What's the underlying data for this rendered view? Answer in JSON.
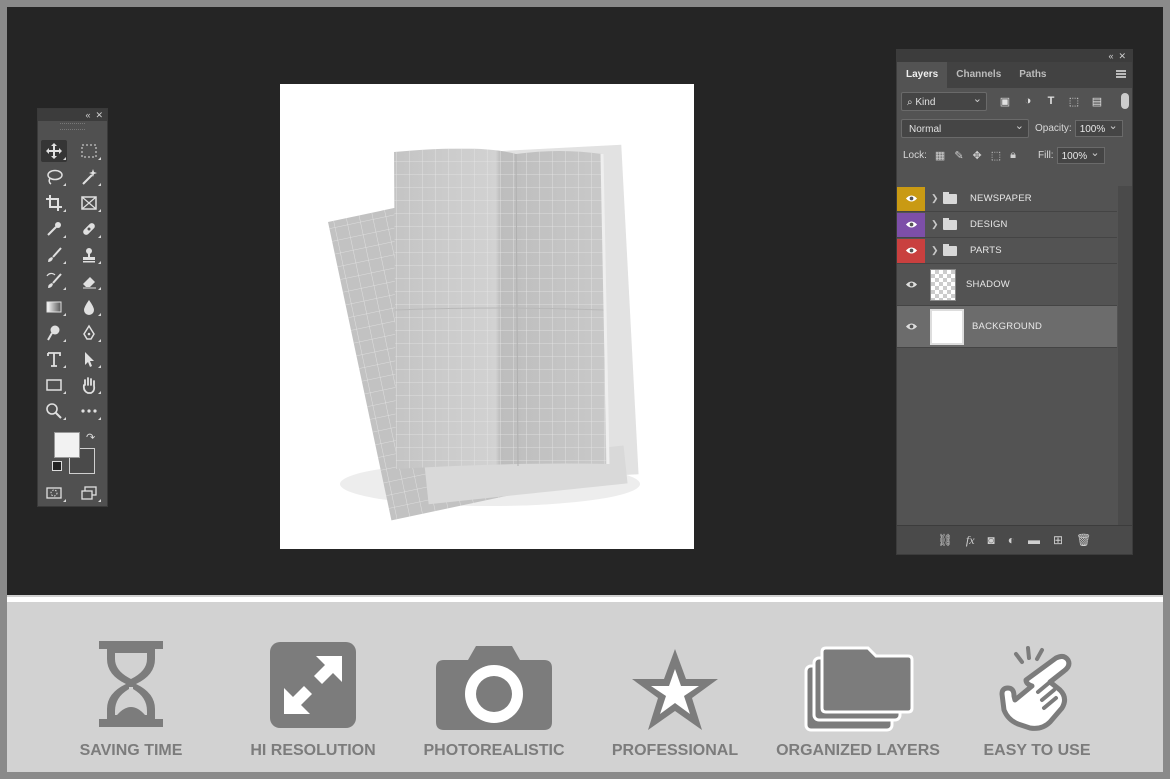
{
  "layers_panel": {
    "tabs": [
      {
        "label": "Layers",
        "active": true
      },
      {
        "label": "Channels",
        "active": false
      },
      {
        "label": "Paths",
        "active": false
      }
    ],
    "filter_kind": "Kind",
    "blend_mode": "Normal",
    "opacity_label": "Opacity:",
    "opacity_value": "100%",
    "lock_label": "Lock:",
    "fill_label": "Fill:",
    "fill_value": "100%",
    "layers": [
      {
        "name": "NEWSPAPER",
        "type": "group",
        "color": "#c99a13"
      },
      {
        "name": "DESIGN",
        "type": "group",
        "color": "#7d4fa8"
      },
      {
        "name": "PARTS",
        "type": "group",
        "color": "#c9403f"
      },
      {
        "name": "SHADOW",
        "type": "layer",
        "color": ""
      },
      {
        "name": "BACKGROUND",
        "type": "layer",
        "color": "",
        "selected": true
      }
    ]
  },
  "features": [
    {
      "label": "SAVING TIME",
      "icon": "hourglass-icon"
    },
    {
      "label": "HI RESOLUTION",
      "icon": "expand-arrows-icon"
    },
    {
      "label": "PHOTOREALISTIC",
      "icon": "camera-icon"
    },
    {
      "label": "PROFESSIONAL",
      "icon": "star-icon"
    },
    {
      "label": "ORGANIZED LAYERS",
      "icon": "stacked-folders-icon"
    },
    {
      "label": "EASY TO USE",
      "icon": "tap-hand-icon"
    }
  ],
  "colors": {
    "workspace": "#252525",
    "panel": "#535353",
    "feature_gray": "#7c7c7c"
  }
}
